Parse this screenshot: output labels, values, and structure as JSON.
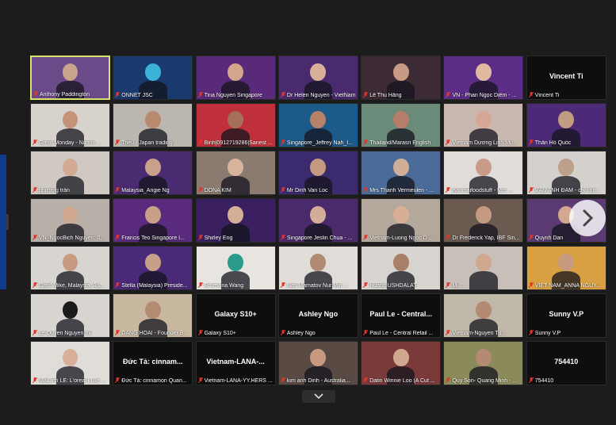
{
  "colors": {
    "background": "#1c1c1c",
    "active_speaker_border": "#d8e26a",
    "mic_muted": "#e2342b"
  },
  "participants": [
    {
      "name": "Anthony Paddington",
      "active": true,
      "type": "video",
      "bg": "#6b4a8a",
      "skin": "#c9a48a"
    },
    {
      "name": "ONNET JSC",
      "type": "video",
      "bg": "#1a3a6e",
      "skin": "#3bb3d8"
    },
    {
      "name": "Tina Nguyen Singapore",
      "type": "video",
      "bg": "#5a2a7a",
      "skin": "#d2a58c"
    },
    {
      "name": "Dr Helen Nguyen - VietNam",
      "type": "video",
      "bg": "#4a2a6e",
      "skin": "#d8b09a"
    },
    {
      "name": "Lê Thu Hằng",
      "type": "video",
      "bg": "#3c2a34",
      "skin": "#c89a84"
    },
    {
      "name": "VN - Phan Ngọc Diễm - ...",
      "type": "video",
      "bg": "#5b2d86",
      "skin": "#e0b9a0"
    },
    {
      "name": "Vincent Ti",
      "type": "name",
      "display": "Vincent Ti"
    },
    {
      "name": "Great Monday - Naomi ...",
      "type": "video",
      "bg": "#d8d2cc",
      "skin": "#c49378"
    },
    {
      "name": "Triều - Japan trading",
      "type": "video",
      "bg": "#bcb6b0",
      "skin": "#b88a70"
    },
    {
      "name": "Binh|0912719286|Sanest ...",
      "type": "video",
      "bg": "#c0303a",
      "skin": "#a4705a"
    },
    {
      "name": "Singapore_Jeffrey Nah_I...",
      "type": "video",
      "bg": "#1c5a8a",
      "skin": "#b8826a"
    },
    {
      "name": "Thailand/Marasri English",
      "type": "video",
      "bg": "#6a8a7a",
      "skin": "#b47e6a"
    },
    {
      "name": "Vietnam Dương Linh Mu...",
      "type": "video",
      "bg": "#c8b8b0",
      "skin": "#d4a894"
    },
    {
      "name": "Thân Hồ Quốc",
      "type": "video",
      "bg": "#4c2a78",
      "skin": "#c29c82"
    },
    {
      "name": "phương trần",
      "type": "video",
      "bg": "#cfc9c2",
      "skin": "#d2ab92"
    },
    {
      "name": "Malaysia_Angie Ng",
      "type": "video",
      "bg": "#4a2a70",
      "skin": "#caa08a"
    },
    {
      "name": "DONA KIM",
      "type": "video",
      "bg": "#8a7a70",
      "skin": "#d8b49c"
    },
    {
      "name": "Mr Dinh Van Loc",
      "type": "video",
      "bg": "#3c2a6e",
      "skin": "#c49a80"
    },
    {
      "name": "Mrs Thanh Vermeulen - ...",
      "type": "video",
      "bg": "#4a6a9a",
      "skin": "#d0ae98"
    },
    {
      "name": "Banmaifoodstuff - Mrs ...",
      "type": "video",
      "bg": "#e0dcd8",
      "skin": "#c89c88"
    },
    {
      "name": "VĂN ANH ĐÀM - cty tinh...",
      "type": "video",
      "bg": "#d4d0cc",
      "skin": "#bca08c"
    },
    {
      "name": "VN_NgocBich Nguyễn: 0...",
      "type": "video",
      "bg": "#b8b0a8",
      "skin": "#d0a890"
    },
    {
      "name": "Francis Teo Singapore I...",
      "type": "video",
      "bg": "#5a2a7e",
      "skin": "#c8a088"
    },
    {
      "name": "Shirley Eng",
      "type": "video",
      "bg": "#3a2060",
      "skin": "#d4ae96"
    },
    {
      "name": "Singapore Jeslin Chua - ...",
      "type": "video",
      "bg": "#4a2a6a",
      "skin": "#d2ae98"
    },
    {
      "name": "Vietnam-Luong Ngoc D...",
      "type": "video",
      "bg": "#b4a89c",
      "skin": "#d8ae94"
    },
    {
      "name": "Dr Frederick Yap, IBF Sin...",
      "type": "video",
      "bg": "#6a5a50",
      "skin": "#c49a80"
    },
    {
      "name": "Quynh Dan",
      "type": "video",
      "bg": "#5a3a70",
      "skin": "#d4a890"
    },
    {
      "name": "Dato' Mike, Malaysia ,As...",
      "type": "video",
      "bg": "#d8d4d0",
      "skin": "#c89a80"
    },
    {
      "name": "Stella (Malaysia) Preside...",
      "type": "video",
      "bg": "#4a2a78",
      "skin": "#c8a088"
    },
    {
      "name": "Ernestina Wang",
      "type": "video",
      "bg": "#e8e4e0",
      "skin": "#2a9a8a"
    },
    {
      "name": "Ilias Mamatov Nur Min ...",
      "type": "video",
      "bg": "#e0dcd8",
      "skin": "#b08a74"
    },
    {
      "name": "Hoàng USHDALAT",
      "type": "video",
      "bg": "#d8d4d0",
      "skin": "#a8806a"
    },
    {
      "name": "Mi ...",
      "type": "video",
      "bg": "#c8c0b8",
      "skin": "#d0a890"
    },
    {
      "name": "VIỆT NAM_ANNA NGUY...",
      "type": "video",
      "bg": "#d8a040",
      "skin": "#c89a80"
    },
    {
      "name": "Le Quyen Nguyen thi",
      "type": "video",
      "bg": "#d8d4d0",
      "skin": "#1a1a1a"
    },
    {
      "name": "DANG HOAI - Founder B...",
      "type": "video",
      "bg": "#c8b8a0",
      "skin": "#b48c74"
    },
    {
      "name": "Galaxy S10+",
      "type": "name",
      "display": "Galaxy S10+"
    },
    {
      "name": "Ashley Ngo",
      "type": "name",
      "display": "Ashley Ngo"
    },
    {
      "name": "Paul Le - Central Retail ...",
      "type": "name",
      "display": "Paul Le - Central..."
    },
    {
      "name": "Vietnam-Nguyen Tu...",
      "type": "video",
      "bg": "#c0b8a8",
      "skin": "#b48a72"
    },
    {
      "name": "Sunny V.P",
      "type": "name",
      "display": "Sunny V.P"
    },
    {
      "name": "MaiLinh LE: L'oreal Luxe ...",
      "type": "video",
      "bg": "#e0dcd8",
      "skin": "#d8b09a"
    },
    {
      "name": "Đức Tả: cinnamon Quan...",
      "type": "name",
      "display": "Đức Tả: cinnam..."
    },
    {
      "name": "Vietnam-LANA-YY.HERS ...",
      "type": "name",
      "display": "Vietnam-LANA-..."
    },
    {
      "name": "kim anh Dinh - Australia...",
      "type": "video",
      "bg": "#5a4a44",
      "skin": "#c89a80"
    },
    {
      "name": "Datin Winnie Loo (A Cut ...",
      "type": "video",
      "bg": "#7a3a3a",
      "skin": "#d0a890"
    },
    {
      "name": "Quy Son- Quang Minh - ...",
      "type": "video",
      "bg": "#8a8a5a",
      "skin": "#b48a72"
    },
    {
      "name": "754410",
      "type": "name",
      "display": "754410"
    }
  ],
  "icons": {
    "next_page": "chevron-right-icon",
    "toggle_panel": "chevron-down-icon",
    "mic": "mic-muted-icon"
  }
}
